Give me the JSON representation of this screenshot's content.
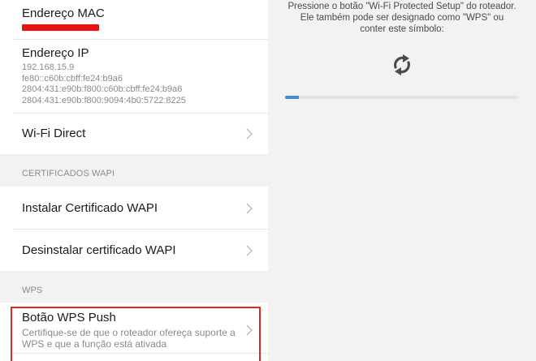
{
  "settings": {
    "mac": {
      "title": "Endereço MAC"
    },
    "ip": {
      "title": "Endereço IP",
      "lines": [
        "192.168.15.9",
        "fe80::c60b:cbff:fe24:b9a6",
        "2804:431:e90b:f800:c60b:cbff:fe24:b9a6",
        "2804:431:e90b:f800:9094:4b0:5722:8225"
      ]
    },
    "wifi_direct": {
      "title": "Wi-Fi Direct"
    },
    "cert_section": "CERTIFICADOS WAPI",
    "install_cert": {
      "title": "Instalar Certificado WAPI"
    },
    "uninstall_cert": {
      "title": "Desinstalar certificado WAPI"
    },
    "wps_section": "WPS",
    "wps_push": {
      "title": "Botão WPS Push",
      "sub": [
        "Certifique-se de que o roteador ofereça suporte a",
        "WPS e que a função está ativada"
      ]
    }
  },
  "dialog": {
    "message": [
      "Pressione o botão \"Wi-Fi Protected Setup\" do roteador.",
      "Ele também pode ser designado como \"WPS\" ou",
      "conter este símbolo:"
    ],
    "icon": "wps-sync-icon",
    "progress": 0.06
  },
  "colors": {
    "highlight": "#d42b2b",
    "redaction": "#ee1111",
    "progress": "#3d8fd1"
  }
}
